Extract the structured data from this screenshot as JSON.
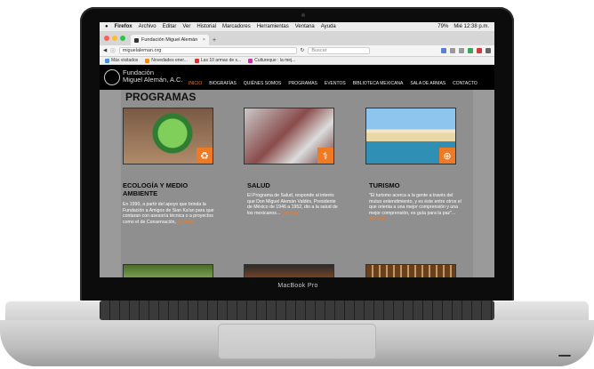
{
  "menubar": {
    "apple": "",
    "app": "Firefox",
    "items": [
      "Archivo",
      "Editar",
      "Ver",
      "Historial",
      "Marcadores",
      "Herramientas",
      "Ventana",
      "Ayuda"
    ],
    "battery": "79%",
    "clock": "Mié 12:38 p.m."
  },
  "browser": {
    "tab_title": "Fundación Miguel Alemán",
    "url": "miguelaleman.org",
    "search_placeholder": "Buscar",
    "bookmarks": [
      "Más visitados",
      "Novedades ener...",
      "Las 10 armas de s...",
      "Cultureque : la mej..."
    ]
  },
  "site": {
    "logo_line1": "Fundación",
    "logo_line2": "Miguel Alemán, A.C.",
    "nav": [
      "INICIO",
      "BIOGRAFÍAS",
      "QUIÉNES SOMOS",
      "PROGRAMAS",
      "EVENTOS",
      "BIBLIOTECA MEXICANA",
      "SALA DE ARMAS",
      "CONTACTO"
    ],
    "active_nav": "INICIO"
  },
  "page": {
    "title": "PROGRAMAS",
    "cards": [
      {
        "title": "ECOLOGÍA Y MEDIO AMBIENTE",
        "text": "En 1990, a partir del apoyo que brinda la Fundación a Amigos de Sian Ka'an para que contaran con asesoría técnica o a proyectos como el de Conservación,",
        "more": "ver más",
        "icon": "recycle-icon"
      },
      {
        "title": "SALUD",
        "text": "El Programa de Salud, responde al interés que Don Miguel Alemán Valdés, Presidente de México de 1946 a 1952, dio a la salud de los mexicanos...",
        "more": "ver más",
        "icon": "stethoscope-icon"
      },
      {
        "title": "TURISMO",
        "text": "\"El turismo acerca a la gente a través del mutuo entendimiento, y es éste entre otros el que orienta a una mejor comprensión y una mejor comprensión, es guía para la paz\"...",
        "more": "ver más",
        "icon": "globe-icon"
      }
    ]
  },
  "device": {
    "model": "MacBook Pro"
  }
}
